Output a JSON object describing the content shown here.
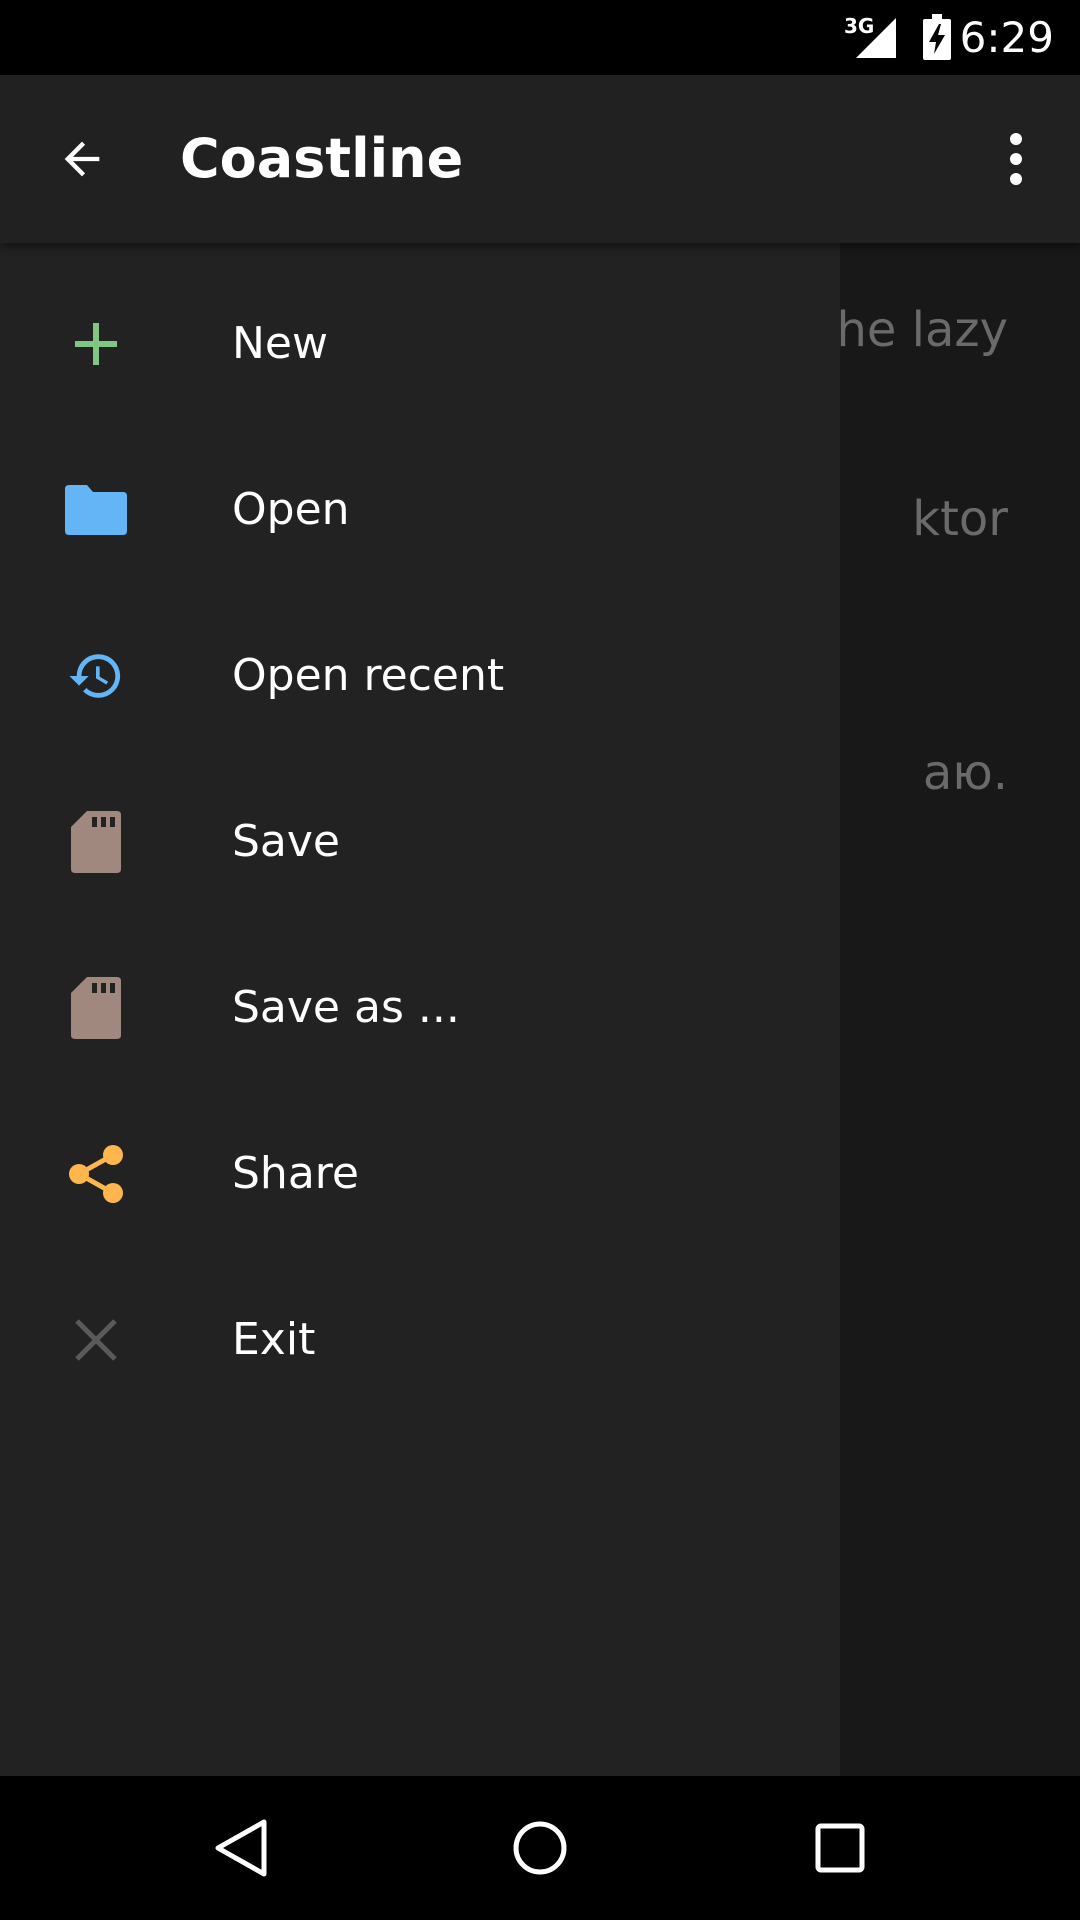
{
  "status_bar": {
    "network": "3G",
    "time": "6:29"
  },
  "toolbar": {
    "title": "Coastline",
    "back_icon": "arrow-left-icon",
    "overflow_icon": "more-vertical-icon"
  },
  "document": {
    "lines": [
      "he lazy",
      "ktor",
      "аю."
    ]
  },
  "drawer": {
    "items": [
      {
        "label": "New",
        "icon": "plus-icon",
        "color": "#81c784"
      },
      {
        "label": "Open",
        "icon": "folder-icon",
        "color": "#64b5f6"
      },
      {
        "label": "Open recent",
        "icon": "history-icon",
        "color": "#64b5f6"
      },
      {
        "label": "Save",
        "icon": "sd-card-icon",
        "color": "#a1887f"
      },
      {
        "label": "Save as ...",
        "icon": "sd-card-icon",
        "color": "#a1887f"
      },
      {
        "label": "Share",
        "icon": "share-icon",
        "color": "#ffb74d"
      },
      {
        "label": "Exit",
        "icon": "close-icon",
        "color": "#5a5a5a"
      }
    ]
  },
  "nav_bar": {
    "back_icon": "nav-back-icon",
    "home_icon": "nav-home-icon",
    "recents_icon": "nav-recents-icon"
  }
}
